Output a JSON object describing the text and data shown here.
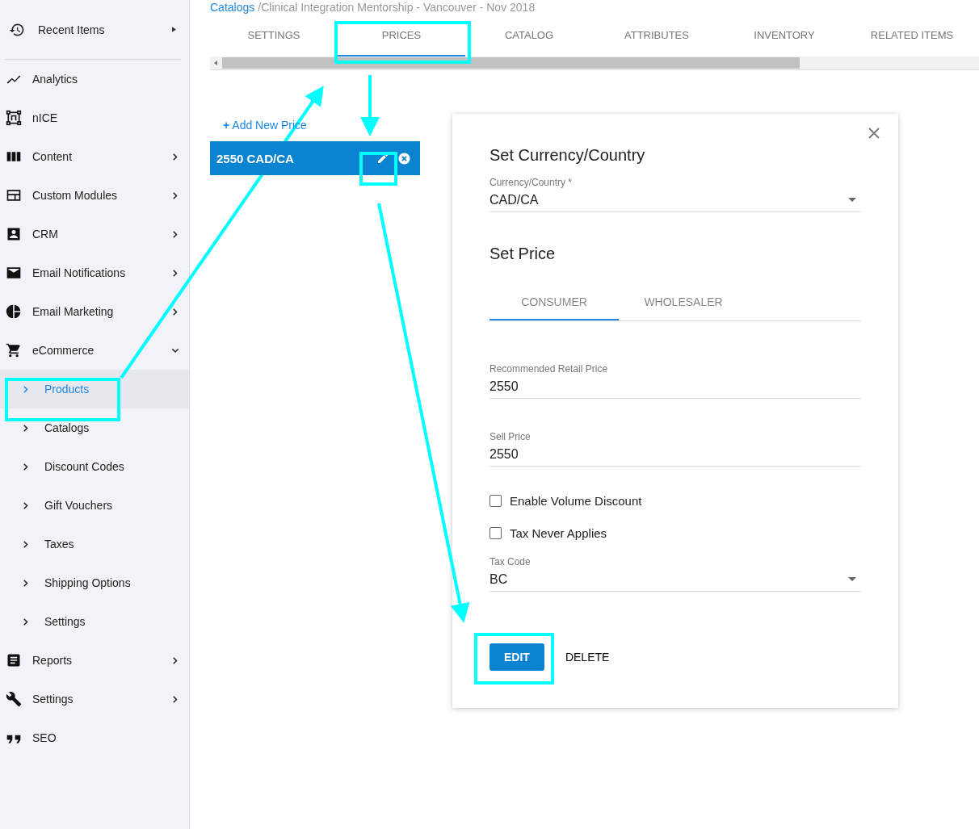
{
  "sidebar": {
    "recent_items": {
      "label": "Recent Items"
    },
    "items": [
      {
        "label": "Analytics",
        "expandable": false
      },
      {
        "label": "nICE",
        "expandable": false
      },
      {
        "label": "Content",
        "expandable": true,
        "expanded": false
      },
      {
        "label": "Custom Modules",
        "expandable": true,
        "expanded": false
      },
      {
        "label": "CRM",
        "expandable": true,
        "expanded": false
      },
      {
        "label": "Email Notifications",
        "expandable": true,
        "expanded": false
      },
      {
        "label": "Email Marketing",
        "expandable": true,
        "expanded": false
      },
      {
        "label": "eCommerce",
        "expandable": true,
        "expanded": true,
        "children": [
          {
            "label": "Products",
            "selected": true
          },
          {
            "label": "Catalogs",
            "selected": false
          },
          {
            "label": "Discount Codes",
            "selected": false
          },
          {
            "label": "Gift Vouchers",
            "selected": false
          },
          {
            "label": "Taxes",
            "selected": false
          },
          {
            "label": "Shipping Options",
            "selected": false
          },
          {
            "label": "Settings",
            "selected": false
          }
        ]
      },
      {
        "label": "Reports",
        "expandable": true,
        "expanded": false
      },
      {
        "label": "Settings",
        "expandable": true,
        "expanded": false
      },
      {
        "label": "SEO",
        "expandable": false
      }
    ]
  },
  "breadcrumb": {
    "link": "Catalogs",
    "current": "/Clinical Integration Mentorship - Vancouver - Nov 2018"
  },
  "tabs": [
    {
      "label": "SETTINGS",
      "selected": false
    },
    {
      "label": "PRICES",
      "selected": true
    },
    {
      "label": "CATALOG",
      "selected": false
    },
    {
      "label": "ATTRIBUTES",
      "selected": false
    },
    {
      "label": "INVENTORY",
      "selected": false
    },
    {
      "label": "RELATED ITEMS",
      "selected": false
    }
  ],
  "add_price": {
    "plus": "+",
    "label": "Add New Price"
  },
  "prices": [
    {
      "label": "2550 CAD/CA",
      "selected": true
    }
  ],
  "dialog": {
    "currency_title": "Set Currency/Country",
    "currency_field": {
      "label": "Currency/Country *",
      "value": "CAD/CA"
    },
    "price_title": "Set Price",
    "price_tabs": [
      {
        "label": "CONSUMER",
        "selected": true
      },
      {
        "label": "WHOLESALER",
        "selected": false
      }
    ],
    "fields": [
      {
        "label": "Recommended Retail Price",
        "value": "2550"
      },
      {
        "label": "Sell Price",
        "value": "2550"
      }
    ],
    "checkboxes": [
      {
        "label": "Enable Volume Discount",
        "checked": false
      },
      {
        "label": "Tax Never Applies",
        "checked": false
      }
    ],
    "tax_field": {
      "label": "Tax Code",
      "value": "BC"
    },
    "buttons": [
      {
        "label": "EDIT",
        "kind": "primary"
      },
      {
        "label": "DELETE",
        "kind": "text"
      }
    ]
  }
}
